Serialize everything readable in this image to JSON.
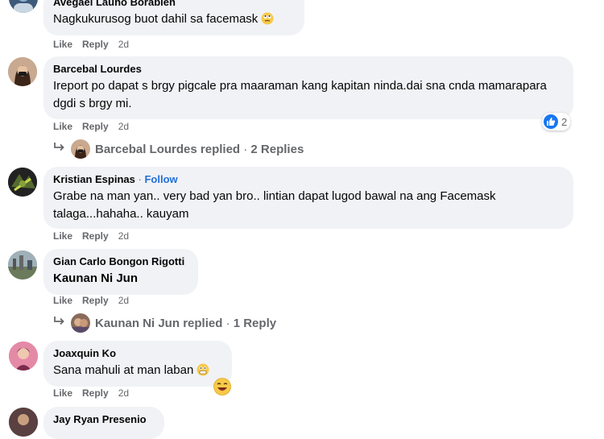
{
  "actions": {
    "like": "Like",
    "reply": "Reply"
  },
  "comments": [
    {
      "author": "Avegael Lauño Borabien",
      "text": "Nagkukurusog buot dahil sa facemask",
      "time": "2d"
    },
    {
      "author": "Barcebal Lourdes",
      "text": "Ireport po dapat s brgy pigcale pra maaraman kang kapitan ninda.dai sna cnda mamarapara dgdi s brgy mi.",
      "time": "2d",
      "reaction_count": "2",
      "replies": {
        "replier": "Barcebal Lourdes",
        "replied": "replied",
        "separator": "·",
        "count": "2 Replies"
      }
    },
    {
      "author": "Kristian Espinas",
      "follow": "Follow",
      "separator": "·",
      "text": "Grabe na man yan.. very bad yan bro.. lintian dapat lugod bawal na ang Facemask talaga...hahaha.. kauyam",
      "time": "2d"
    },
    {
      "author": "Gian Carlo Bongon Rigotti",
      "text": "Kaunan Ni Jun",
      "time": "2d",
      "replies": {
        "replier": "Kaunan Ni Jun",
        "replied": "replied",
        "separator": "·",
        "count": "1 Reply"
      }
    },
    {
      "author": "Joaxquin Ko",
      "text": "Sana mahuli at man laban",
      "time": "2d"
    },
    {
      "author": "Jay Ryan Presenio"
    }
  ],
  "colors": {
    "bubble": "#f0f2f5",
    "link": "#216fdb",
    "meta": "#65676b",
    "like_blue": "#1877f2"
  },
  "icons": {
    "reply_arrow": "reply-arrow-icon",
    "like": "thumbs-up-icon"
  }
}
